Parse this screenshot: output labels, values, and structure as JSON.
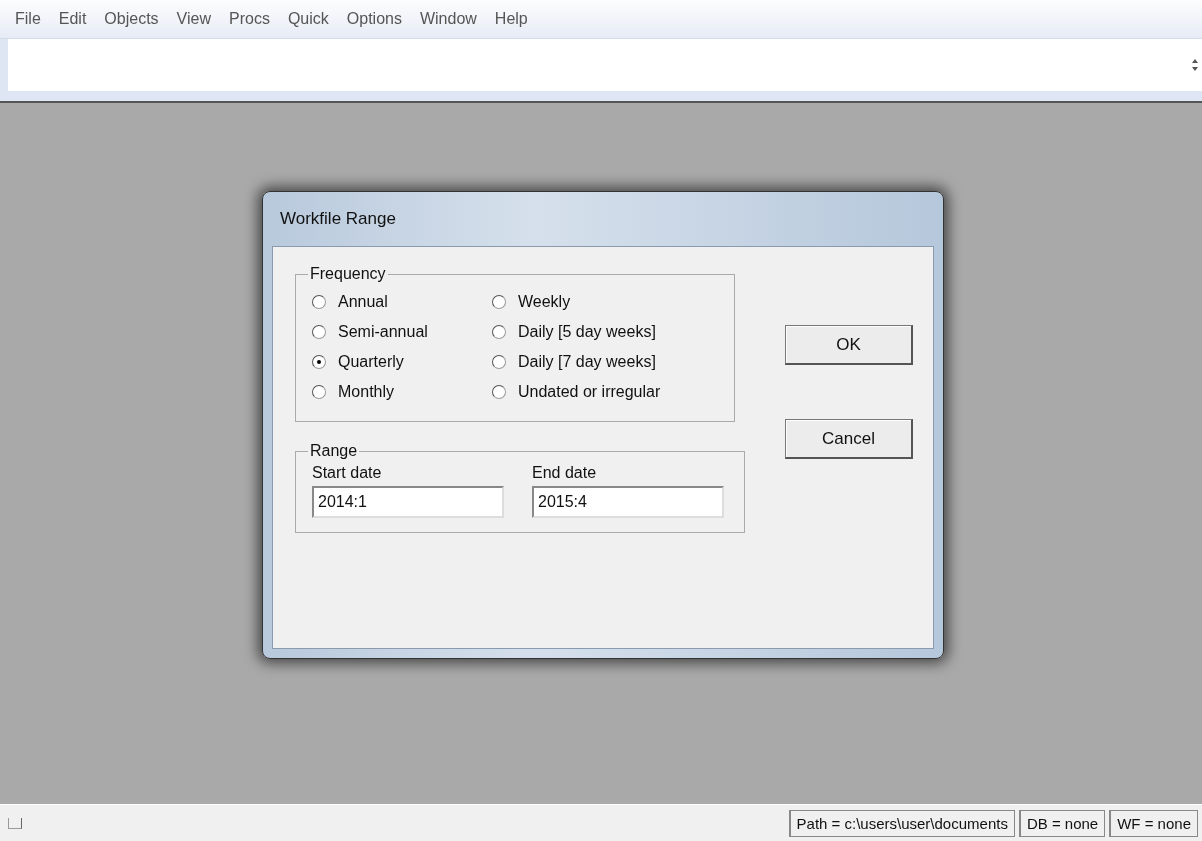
{
  "menu_bar": {
    "items": [
      "File",
      "Edit",
      "Objects",
      "View",
      "Procs",
      "Quick",
      "Options",
      "Window",
      "Help"
    ]
  },
  "dialog": {
    "title": "Workfile Range",
    "frequency": {
      "label": "Frequency",
      "options": [
        {
          "label": "Annual",
          "selected": false
        },
        {
          "label": "Semi-annual",
          "selected": false
        },
        {
          "label": "Quarterly",
          "selected": true
        },
        {
          "label": "Monthly",
          "selected": false
        },
        {
          "label": "Weekly",
          "selected": false
        },
        {
          "label": "Daily [5 day weeks]",
          "selected": false
        },
        {
          "label": "Daily [7 day weeks]",
          "selected": false
        },
        {
          "label": "Undated or irregular",
          "selected": false
        }
      ]
    },
    "range": {
      "label": "Range",
      "start": {
        "label": "Start date",
        "value": "2014:1"
      },
      "end": {
        "label": "End date",
        "value": "2015:4"
      }
    },
    "buttons": [
      "OK",
      "Cancel"
    ]
  },
  "status_bar": {
    "path": "Path = c:\\users\\user\\documents",
    "db": "DB = none",
    "wf": "WF = none"
  }
}
